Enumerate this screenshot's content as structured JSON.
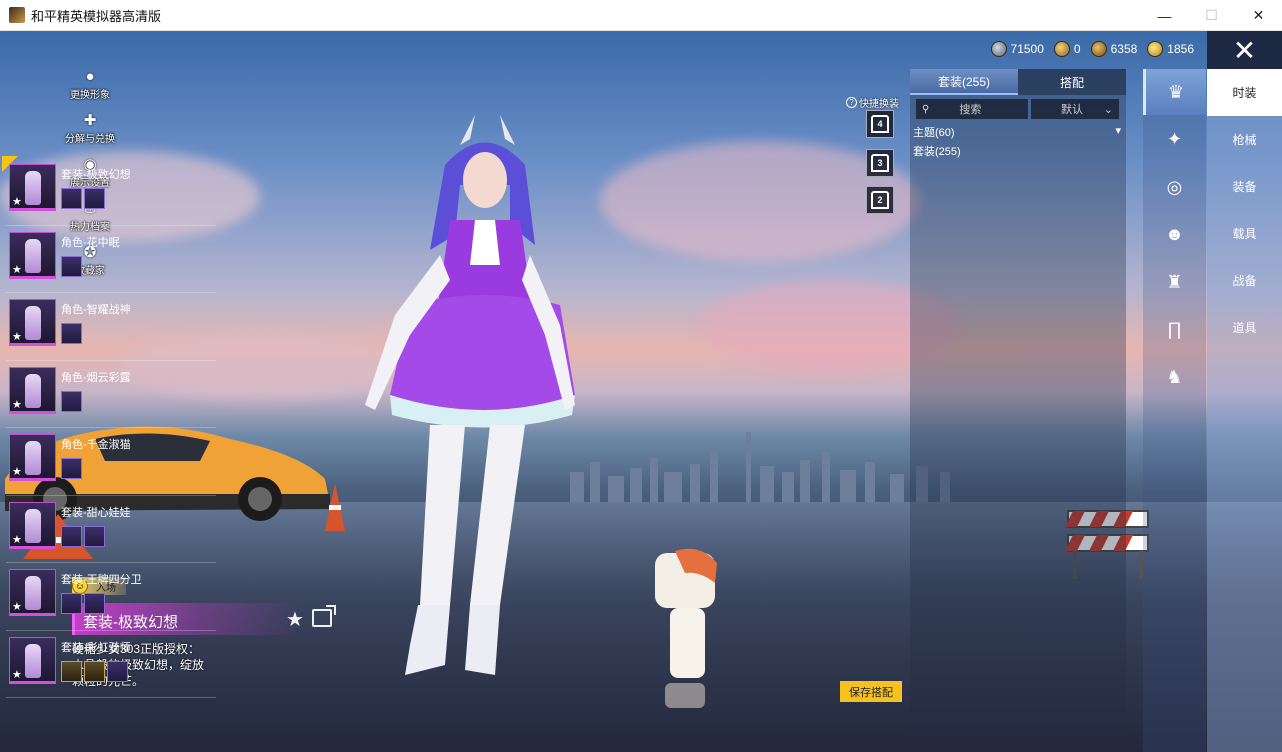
{
  "window": {
    "title": "和平精英模拟器高清版",
    "min": "—",
    "max": "☐",
    "close": "✕"
  },
  "currency": [
    {
      "icon": "silver-coin-icon",
      "value": "71500"
    },
    {
      "icon": "badge-coin-icon",
      "value": "0"
    },
    {
      "icon": "bronze-coin-icon",
      "value": "6358"
    },
    {
      "icon": "gold-coin-icon",
      "value": "1856"
    }
  ],
  "left_menu": [
    {
      "icon": "person-icon",
      "glyph": "●",
      "label": "更换形象"
    },
    {
      "icon": "puzzle-icon",
      "glyph": "✚",
      "label": "分解与兑换"
    },
    {
      "icon": "eye-icon",
      "glyph": "◉",
      "label": "展示设置"
    },
    {
      "icon": "flame-icon",
      "glyph": "♨",
      "label": "热力档案"
    },
    {
      "icon": "badge-icon",
      "glyph": "✪",
      "label": "收藏家"
    }
  ],
  "suit_info": {
    "entry_label": "入场",
    "title": "套装-极致幻想",
    "description": "硬糖少女303正版授权：水晶般的极致幻想，绽放颗粒的光芒。"
  },
  "quick_change": {
    "label": "快捷换装",
    "slots": [
      "4",
      "3",
      "2"
    ]
  },
  "save_button": "保存搭配",
  "list_panel": {
    "tabs": [
      "套装(255)",
      "搭配"
    ],
    "search_placeholder": "搜索",
    "sort": "默认",
    "theme": "主题(60)",
    "suit_count": "套装(255)",
    "items": [
      {
        "name": "套装-极致幻想",
        "parts": 2,
        "gold": false,
        "selected": true
      },
      {
        "name": "角色-花中眠",
        "parts": 1,
        "gold": false,
        "selected": false
      },
      {
        "name": "角色-智耀战神",
        "parts": 1,
        "gold": false,
        "selected": false
      },
      {
        "name": "角色-烟云彩露",
        "parts": 1,
        "gold": false,
        "selected": false
      },
      {
        "name": "角色-千金淑猫",
        "parts": 1,
        "gold": false,
        "selected": false
      },
      {
        "name": "套装-甜心娃娃",
        "parts": 2,
        "gold": false,
        "selected": false
      },
      {
        "name": "套装-王牌四分卫",
        "parts": 2,
        "gold": false,
        "selected": false
      },
      {
        "name": "套装-彩虹骑师",
        "parts": 3,
        "gold": true,
        "selected": false
      }
    ]
  },
  "categories": [
    {
      "icon": "outfit-icon",
      "glyph": "♛"
    },
    {
      "icon": "gun-skin-icon",
      "glyph": "✦"
    },
    {
      "icon": "glasses-icon",
      "glyph": "◎"
    },
    {
      "icon": "mask-icon",
      "glyph": "☻"
    },
    {
      "icon": "top-icon",
      "glyph": "♜"
    },
    {
      "icon": "pants-icon",
      "glyph": "∏"
    },
    {
      "icon": "shoes-icon",
      "glyph": "♞"
    }
  ],
  "nav": [
    "时装",
    "枪械",
    "装备",
    "载具",
    "战备",
    "道具"
  ]
}
